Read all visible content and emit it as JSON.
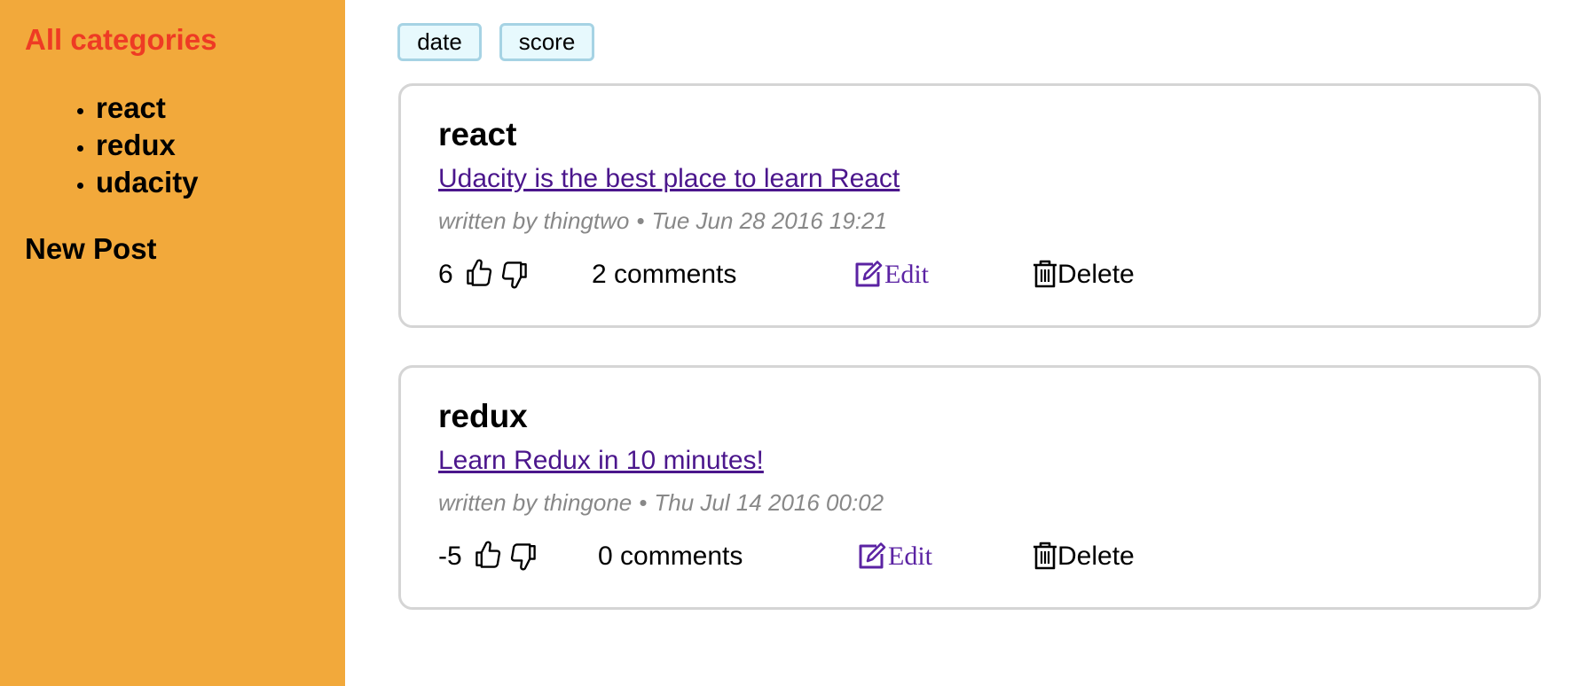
{
  "sidebar": {
    "all_categories_label": "All categories",
    "categories": [
      "react",
      "redux",
      "udacity"
    ],
    "new_post_label": "New Post"
  },
  "sort": {
    "date_label": "date",
    "score_label": "score"
  },
  "posts": [
    {
      "category": "react",
      "title": "Udacity is the best place to learn React",
      "author_text": "written by thingtwo",
      "separator": "•",
      "date": "Tue Jun 28 2016 19:21",
      "score": "6",
      "comments": "2 comments",
      "edit_label": "Edit",
      "delete_label": "Delete"
    },
    {
      "category": "redux",
      "title": "Learn Redux in 10 minutes!",
      "author_text": "written by thingone",
      "separator": "•",
      "date": "Thu Jul 14 2016 00:02",
      "score": "-5",
      "comments": "0 comments",
      "edit_label": "Edit",
      "delete_label": "Delete"
    }
  ],
  "icons": {
    "upvote": "thumbs-up-icon",
    "downvote": "thumbs-down-icon",
    "edit": "edit-icon",
    "delete": "trash-icon"
  },
  "colors": {
    "sidebar_bg": "#f2a93b",
    "all_categories": "#ee3b24",
    "link": "#4b168c",
    "edit": "#5b23a3",
    "sort_button_bg": "#e7f9fd",
    "sort_button_border": "#a6d3e4",
    "card_border": "#d5d5d5",
    "meta_text": "#888888"
  }
}
